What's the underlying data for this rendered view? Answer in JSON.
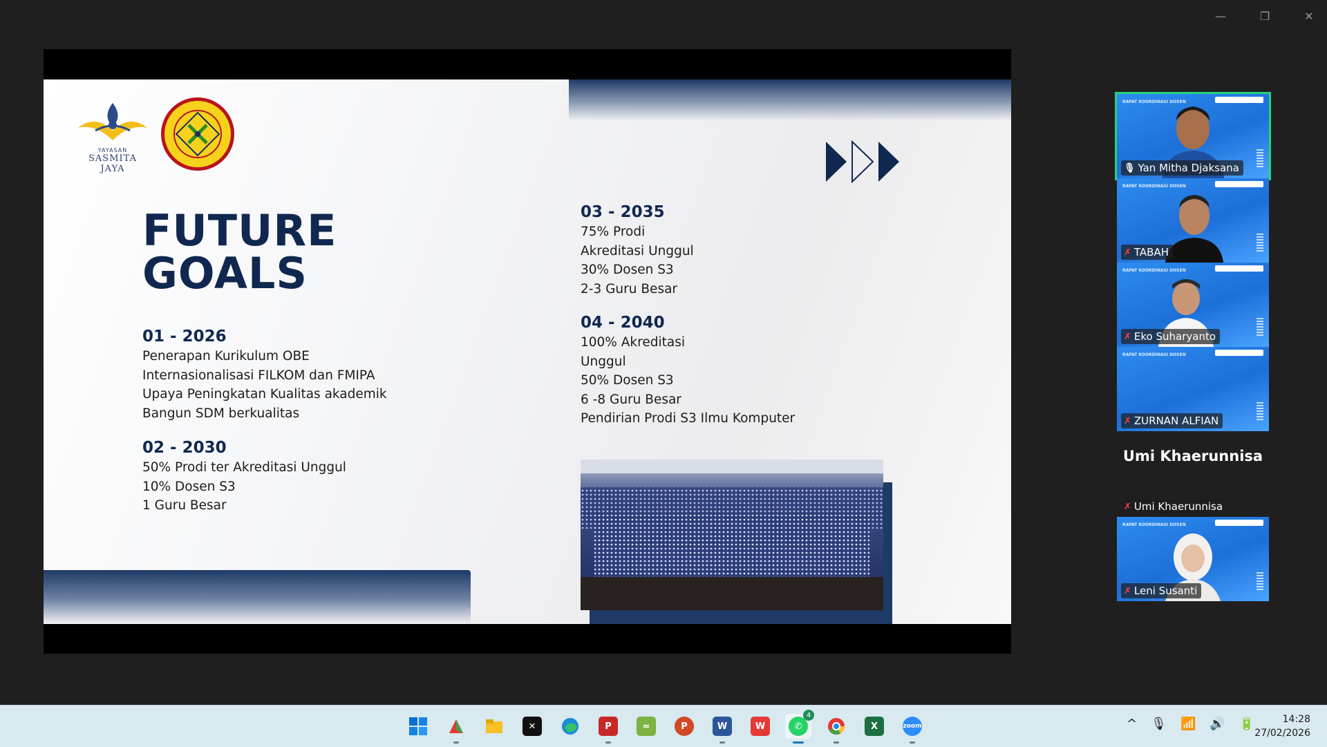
{
  "window": {
    "minimize": "—",
    "restore": "❐",
    "close": "✕"
  },
  "slide": {
    "logo1_small": "YAYASAN",
    "logo1_name": "SASMITA JAYA",
    "logo2_text": "UNIVERSITAS PAMULANG · UNPAM",
    "title_line1": "FUTURE",
    "title_line2": "GOALS",
    "goals": [
      {
        "year": "01 - 2026",
        "items": [
          "Penerapan Kurikulum OBE",
          "Internasionalisasi FILKOM dan FMIPA",
          "Upaya Peningkatan Kualitas akademik",
          "Bangun SDM berkualitas"
        ]
      },
      {
        "year": "02 - 2030",
        "items": [
          "50% Prodi ter Akreditasi Unggul",
          "10% Dosen S3",
          "1 Guru Besar"
        ]
      },
      {
        "year": "03 - 2035",
        "items": [
          "75% Prodi",
          "Akreditasi Unggul",
          "30% Dosen S3",
          "2-3 Guru Besar"
        ]
      },
      {
        "year": "04 - 2040",
        "items": [
          "100% Akreditasi",
          "Unggul",
          "50% Dosen S3",
          "6 -8 Guru Besar",
          "Pendirian Prodi S3 Ilmu Komputer"
        ]
      }
    ]
  },
  "participants": [
    {
      "name": "Yan Mitha Djaksana",
      "muted": false,
      "active": true
    },
    {
      "name": "TABAH",
      "muted": true,
      "active": false
    },
    {
      "name": "Eko Suharyanto",
      "muted": true,
      "active": false
    },
    {
      "name": "ZURNAN ALFIAN",
      "muted": true,
      "active": false
    },
    {
      "name": "Umi Khaerunnisa",
      "muted": true,
      "active": false,
      "video_off": true
    },
    {
      "name": "Leni Susanti",
      "muted": true,
      "active": false
    }
  ],
  "big_name": "Umi Khaerunnisa",
  "tile_header": "RAPAT KOORDINASI DOSEN",
  "taskbar": {
    "apps": [
      "windows-start",
      "app-generic",
      "file-explorer",
      "capcut",
      "edge",
      "pdf-editor",
      "spreadsheet-app",
      "powerpoint",
      "word",
      "wps-office",
      "whatsapp",
      "chrome",
      "excel",
      "zoom"
    ],
    "whatsapp_badge": "4",
    "time": "14:28",
    "date": "27/02/2026"
  },
  "colors": {
    "navy": "#10284f",
    "speaker": "#29d07c",
    "tile": "#2d8cf0"
  }
}
